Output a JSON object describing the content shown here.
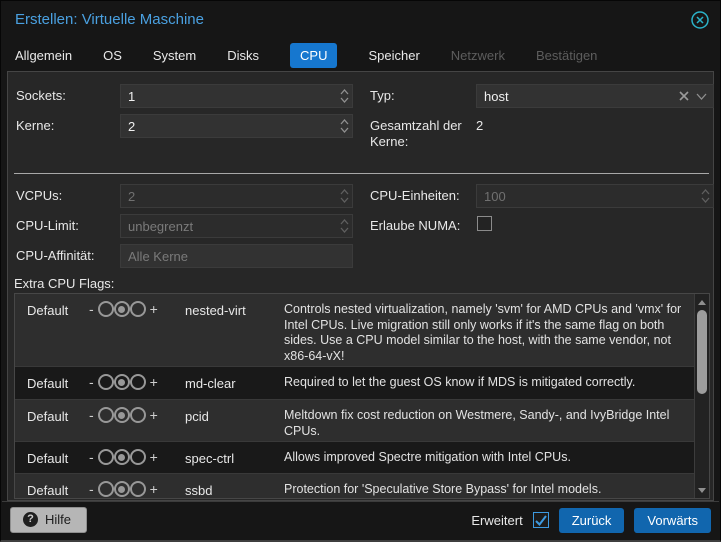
{
  "dialog": {
    "title": "Erstellen: Virtuelle Maschine"
  },
  "colors": {
    "accent_tab_blue": "#1677cf",
    "button_blue": "#1166ae",
    "title_blue": "#4aa0e0",
    "close_teal": "#2bb3c9"
  },
  "tabs": [
    {
      "label": "Allgemein",
      "state": "normal"
    },
    {
      "label": "OS",
      "state": "normal"
    },
    {
      "label": "System",
      "state": "normal"
    },
    {
      "label": "Disks",
      "state": "normal"
    },
    {
      "label": "CPU",
      "state": "active"
    },
    {
      "label": "Speicher",
      "state": "normal"
    },
    {
      "label": "Netzwerk",
      "state": "disabled"
    },
    {
      "label": "Bestätigen",
      "state": "disabled"
    }
  ],
  "fields": {
    "sockets": {
      "label": "Sockets:",
      "value": "1"
    },
    "kerne": {
      "label": "Kerne:",
      "value": "2"
    },
    "typ": {
      "label": "Typ:",
      "value": "host"
    },
    "gesamtzahl": {
      "label": "Gesamtzahl der Kerne:",
      "value": "2"
    },
    "vcpus": {
      "label": "VCPUs:",
      "value": "2",
      "disabled": true
    },
    "cpu_limit": {
      "label": "CPU-Limit:",
      "placeholder": "unbegrenzt",
      "disabled": true
    },
    "cpu_affinitaet": {
      "label": "CPU-Affinität:",
      "placeholder": "Alle Kerne"
    },
    "cpu_einheiten": {
      "label": "CPU-Einheiten:",
      "value": "100",
      "disabled": true
    },
    "numa": {
      "label": "Erlaube NUMA:",
      "checked": false
    }
  },
  "flags": {
    "label": "Extra CPU Flags:",
    "minus": "-",
    "plus": "+",
    "rows": [
      {
        "state_label": "Default",
        "flag": "nested-virt",
        "selected": "default",
        "description": "Controls nested virtualization, namely 'svm' for AMD CPUs and 'vmx' for Intel CPUs. Live migration still only works if it's the same flag on both sides. Use a CPU model similar to the host, with the same vendor, not x86-64-vX!"
      },
      {
        "state_label": "Default",
        "flag": "md-clear",
        "selected": "default",
        "description": "Required to let the guest OS know if MDS is mitigated correctly."
      },
      {
        "state_label": "Default",
        "flag": "pcid",
        "selected": "default",
        "description": "Meltdown fix cost reduction on Westmere, Sandy-, and IvyBridge Intel CPUs."
      },
      {
        "state_label": "Default",
        "flag": "spec-ctrl",
        "selected": "default",
        "description": "Allows improved Spectre mitigation with Intel CPUs."
      },
      {
        "state_label": "Default",
        "flag": "ssbd",
        "selected": "default",
        "description": "Protection for 'Speculative Store Bypass' for Intel models."
      }
    ]
  },
  "icons": {
    "help_glyph": "?"
  },
  "footer": {
    "help_label": "Hilfe",
    "advanced_label": "Erweitert",
    "advanced_checked": true,
    "back_label": "Zurück",
    "forward_label": "Vorwärts"
  }
}
